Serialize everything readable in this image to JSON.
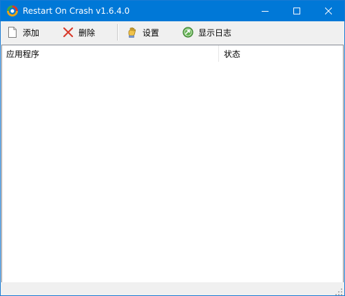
{
  "window": {
    "title": "Restart On Crash v1.6.4.0",
    "app_icon": "restart-on-crash-app-icon",
    "accent": "#0078d7",
    "caption_buttons": [
      "minimize-icon",
      "maximize-icon",
      "close-icon"
    ]
  },
  "toolbar": {
    "add_label": "添加",
    "add_icon": "document-icon",
    "delete_label": "删除",
    "delete_icon": "red-x-icon",
    "settings_label": "设置",
    "settings_icon": "hand-icon",
    "show_log_label": "显示日志",
    "show_log_icon": "green-arrow-log-icon"
  },
  "list": {
    "columns": [
      "应用程序",
      "状态"
    ],
    "rows": []
  }
}
